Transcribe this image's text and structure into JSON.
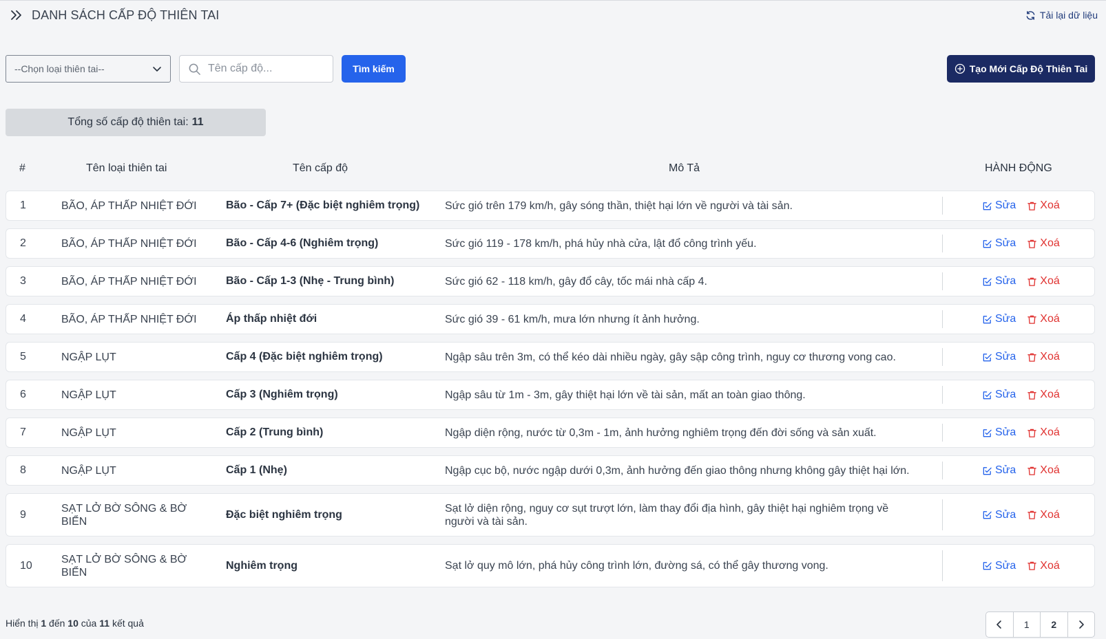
{
  "header": {
    "title": "DANH SÁCH CẤP ĐỘ THIÊN TAI",
    "reload_label": "Tải lại dữ liệu"
  },
  "filters": {
    "select_value": "--Chọn loại thiên tai--",
    "search_placeholder": "Tên cấp độ...",
    "search_button": "Tìm kiếm",
    "create_button": "Tạo Mới Cấp Độ Thiên Tai"
  },
  "summary": {
    "label": "Tổng số cấp độ thiên tai:",
    "count": "11"
  },
  "table": {
    "columns": [
      "#",
      "Tên loại thiên tai",
      "Tên cấp độ",
      "Mô Tả",
      "HÀNH ĐỘNG"
    ],
    "edit_label": "Sửa",
    "delete_label": "Xoá",
    "rows": [
      {
        "idx": "1",
        "type": "BÃO, ÁP THẤP NHIỆT ĐỚI",
        "level": "Bão - Cấp 7+ (Đặc biệt nghiêm trọng)",
        "desc": "Sức gió trên 179 km/h, gây sóng thần, thiệt hại lớn về người và tài sản."
      },
      {
        "idx": "2",
        "type": "BÃO, ÁP THẤP NHIỆT ĐỚI",
        "level": "Bão - Cấp 4-6 (Nghiêm trọng)",
        "desc": "Sức gió 119 - 178 km/h, phá hủy nhà cửa, lật đổ công trình yếu."
      },
      {
        "idx": "3",
        "type": "BÃO, ÁP THẤP NHIỆT ĐỚI",
        "level": "Bão - Cấp 1-3 (Nhẹ - Trung bình)",
        "desc": "Sức gió 62 - 118 km/h, gây đổ cây, tốc mái nhà cấp 4."
      },
      {
        "idx": "4",
        "type": "BÃO, ÁP THẤP NHIỆT ĐỚI",
        "level": "Áp thấp nhiệt đới",
        "desc": "Sức gió 39 - 61 km/h, mưa lớn nhưng ít ảnh hưởng."
      },
      {
        "idx": "5",
        "type": "NGẬP LỤT",
        "level": "Cấp 4 (Đặc biệt nghiêm trọng)",
        "desc": "Ngập sâu trên 3m, có thể kéo dài nhiều ngày, gây sập công trình, nguy cơ thương vong cao."
      },
      {
        "idx": "6",
        "type": "NGẬP LỤT",
        "level": "Cấp 3 (Nghiêm trọng)",
        "desc": "Ngập sâu từ 1m - 3m, gây thiệt hại lớn về tài sản, mất an toàn giao thông."
      },
      {
        "idx": "7",
        "type": "NGẬP LỤT",
        "level": "Cấp 2 (Trung bình)",
        "desc": "Ngập diện rộng, nước từ 0,3m - 1m, ảnh hưởng nghiêm trọng đến đời sống và sản xuất."
      },
      {
        "idx": "8",
        "type": "NGẬP LỤT",
        "level": "Cấp 1 (Nhẹ)",
        "desc": "Ngập cục bộ, nước ngập dưới 0,3m, ảnh hưởng đến giao thông nhưng không gây thiệt hại lớn."
      },
      {
        "idx": "9",
        "type": "SẠT LỞ BỜ SÔNG & BỜ BIỂN",
        "level": "Đặc biệt nghiêm trọng",
        "desc": "Sạt lở diện rộng, nguy cơ sụt trượt lớn, làm thay đổi địa hình, gây thiệt hại nghiêm trọng về người và tài sản."
      },
      {
        "idx": "10",
        "type": "SẠT LỞ BỜ SÔNG & BỜ BIỂN",
        "level": "Nghiêm trọng",
        "desc": "Sạt lở quy mô lớn, phá hủy công trình lớn, đường sá, có thể gây thương vong."
      }
    ]
  },
  "footer": {
    "prefix": "Hiển thị",
    "from": "1",
    "to_word": "đến",
    "to": "10",
    "of_word": "của",
    "total": "11",
    "suffix": "kết quả",
    "pages": [
      "1",
      "2"
    ],
    "current_page": "2"
  }
}
